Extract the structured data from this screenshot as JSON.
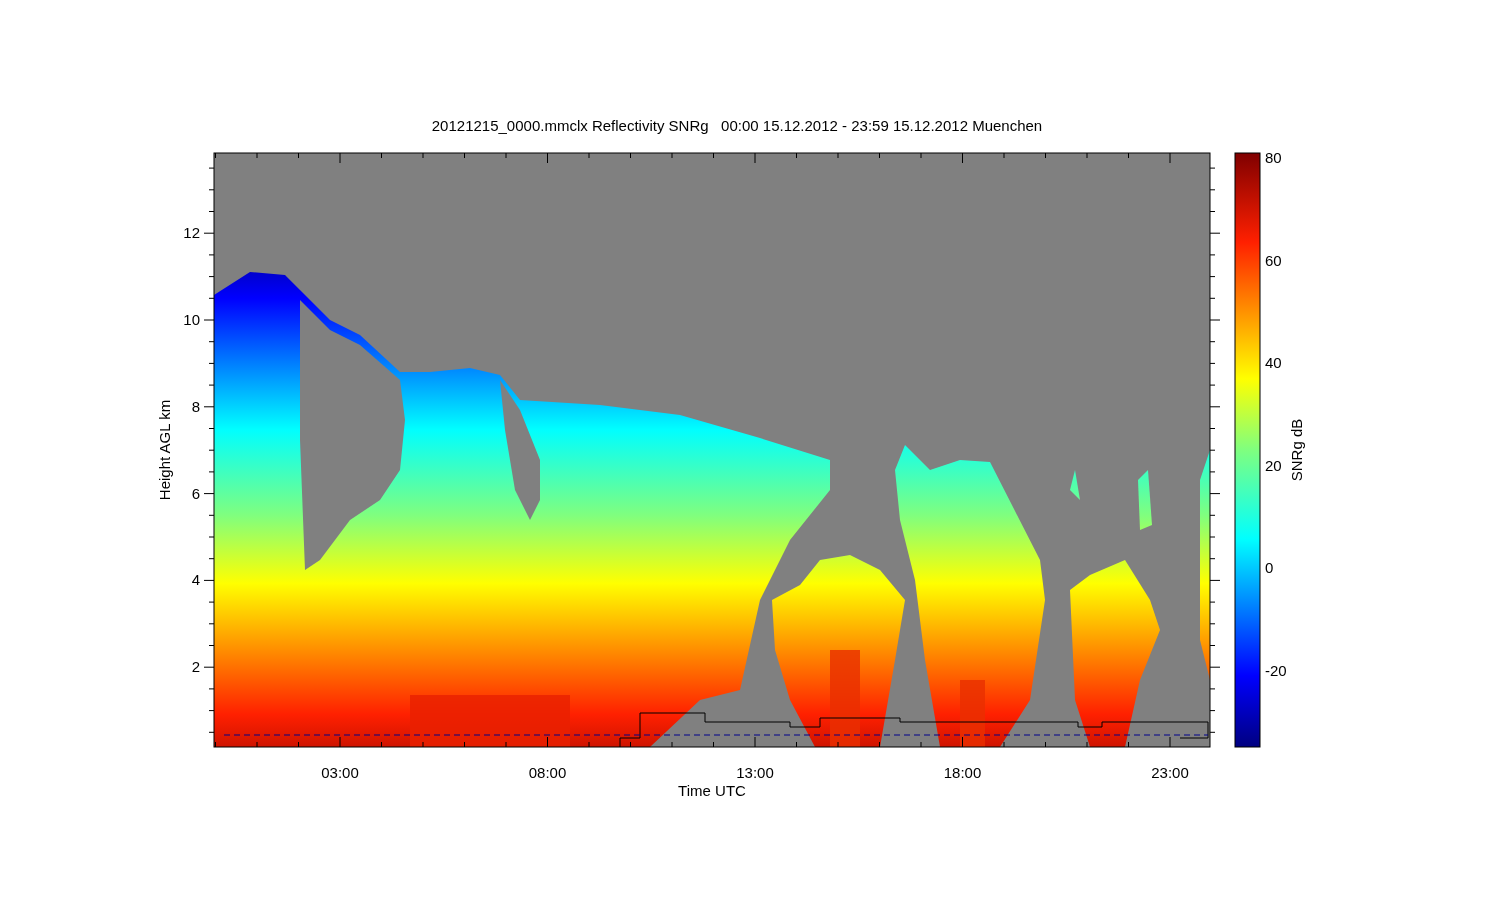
{
  "title": "20121215_0000.mmclx Reflectivity SNRg   00:00 15.12.2012 - 23:59 15.12.2012 Muenchen",
  "x_axis": {
    "label": "Time UTC",
    "ticks": [
      "03:00",
      "08:00",
      "13:00",
      "18:00",
      "23:00"
    ]
  },
  "y_axis": {
    "label": "Height AGL km",
    "ticks": [
      "12",
      "10",
      "8",
      "6",
      "4",
      "2"
    ]
  },
  "colorbar": {
    "label": "SNRg dB",
    "ticks": [
      "80",
      "60",
      "40",
      "20",
      "0",
      "-20"
    ]
  }
}
